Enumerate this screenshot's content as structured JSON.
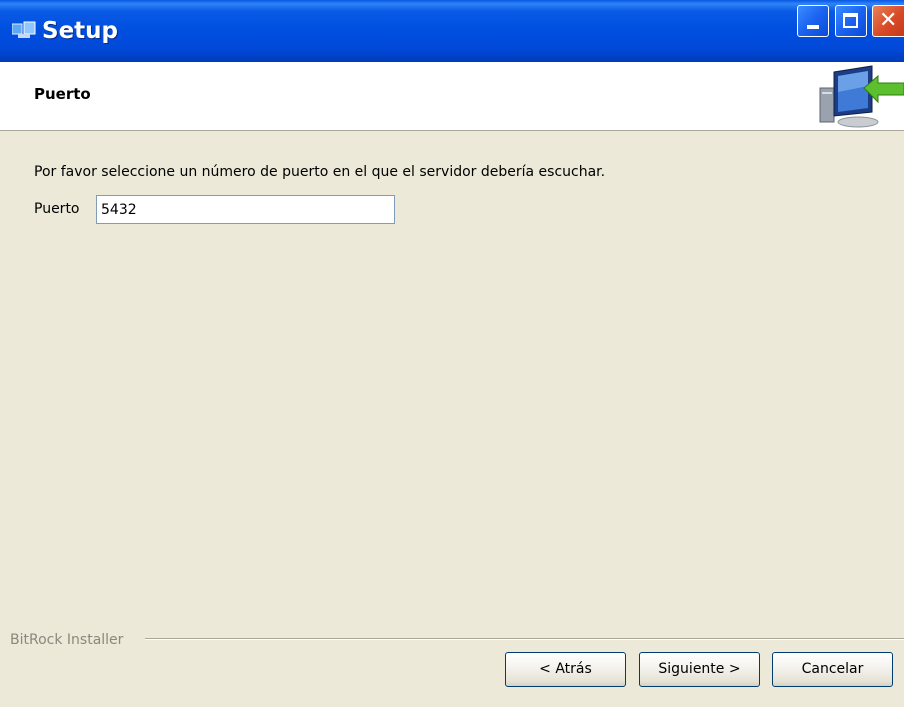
{
  "window": {
    "title": "Setup",
    "controls": {
      "minimize_icon": "minimize-icon",
      "maximize_icon": "maximize-icon",
      "close_icon": "close-icon",
      "close_glyph": "✕"
    }
  },
  "header": {
    "title": "Puerto",
    "art_icon": "computer-install-icon"
  },
  "content": {
    "instruction": "Por favor seleccione un número de puerto en el que el servidor debería escuchar.",
    "port_label": "Puerto",
    "port_value": "5432"
  },
  "footer": {
    "installer_label": "BitRock Installer",
    "back_label": "< Atrás",
    "next_label": "Siguiente >",
    "cancel_label": "Cancelar"
  },
  "colors": {
    "titlebar": "#0050e0",
    "close_button": "#d84a25",
    "background": "#ece9d8",
    "header_background": "#ffffff"
  }
}
